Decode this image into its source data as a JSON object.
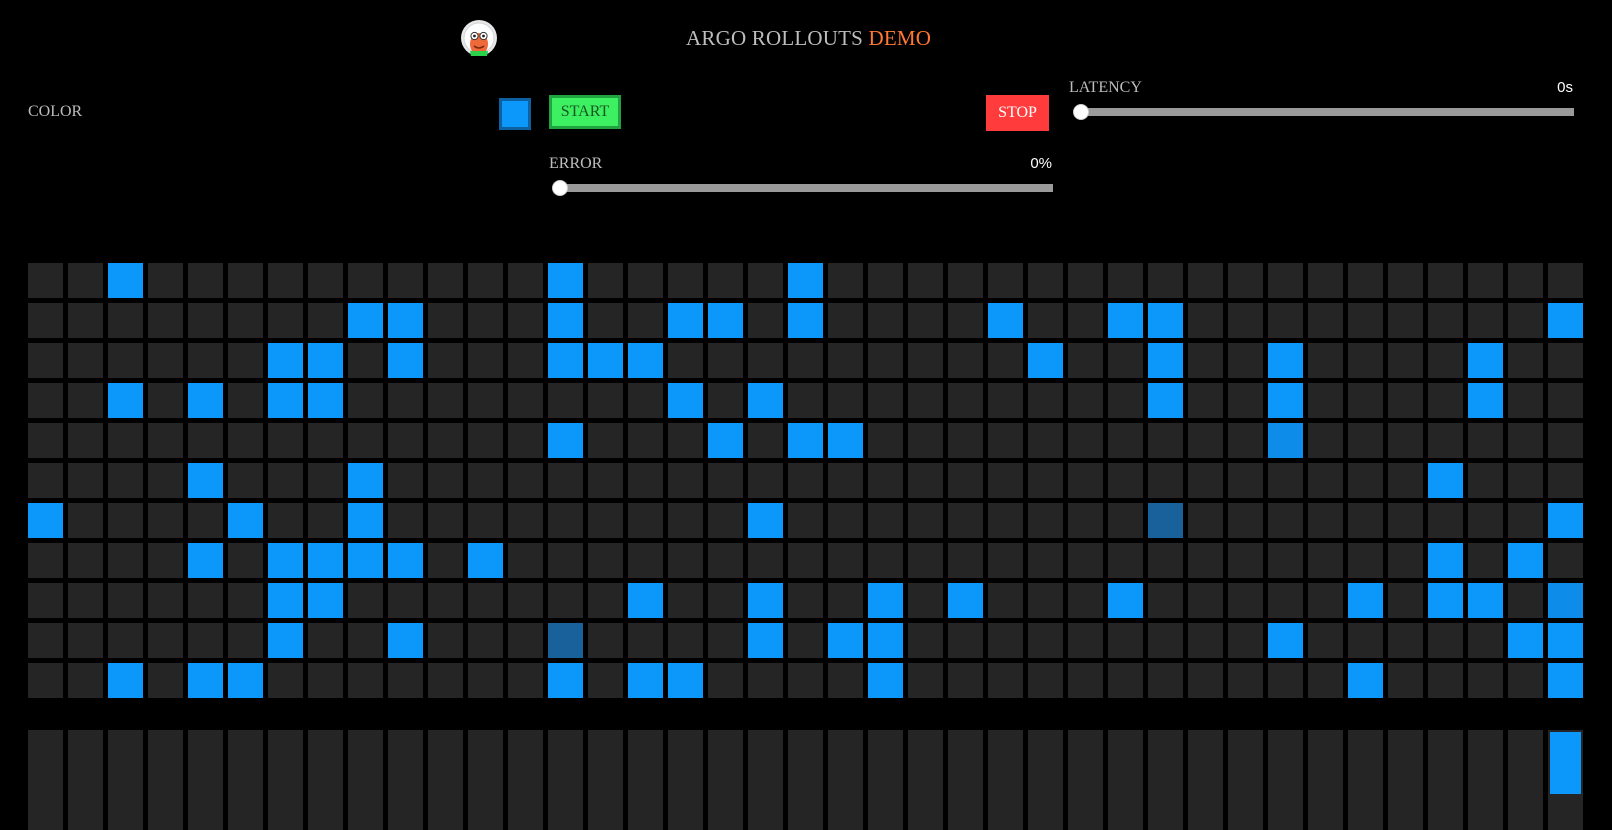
{
  "header": {
    "title_main": "ARGO ROLLOUTS",
    "title_accent": "DEMO",
    "accent_color": "#ff7733",
    "logo_icon": "argo-mascot-icon"
  },
  "controls": {
    "color_label": "COLOR",
    "color_value": "#0c98fa",
    "start_label": "START",
    "stop_label": "STOP",
    "latency": {
      "label": "LATENCY",
      "display": "0s",
      "fraction": 0
    },
    "error": {
      "label": "ERROR",
      "display": "0%",
      "fraction": 0
    }
  },
  "grid": {
    "cols": 39,
    "rows": [
      "..1..........1.....1...................",
      "........11...1..11.1....1..11.........1",
      "......11.1...111.........1..1..1....1..",
      "..1.1.11........1.1.........1..1....1..",
      ".............1...1.11..........2.......",
      "....1...1..........................1...",
      "1....1..1.........1.........3.........1",
      "....1.1111.1.......................1.1.",
      "......11.......1..1..1.1...1.....1.11.2",
      "......1..1...3....1.11.........1.....11",
      "..1.11.......1.11....1...........1....1"
    ]
  },
  "bars": {
    "values": [
      0,
      0,
      0,
      0,
      0,
      0,
      0,
      0,
      0,
      0,
      0,
      0,
      0,
      0,
      0,
      0,
      0,
      0,
      0,
      0,
      0,
      0,
      0,
      0,
      0,
      0,
      0,
      0,
      0,
      0,
      0,
      0,
      0,
      0,
      0,
      0,
      0,
      0,
      0.62
    ]
  }
}
